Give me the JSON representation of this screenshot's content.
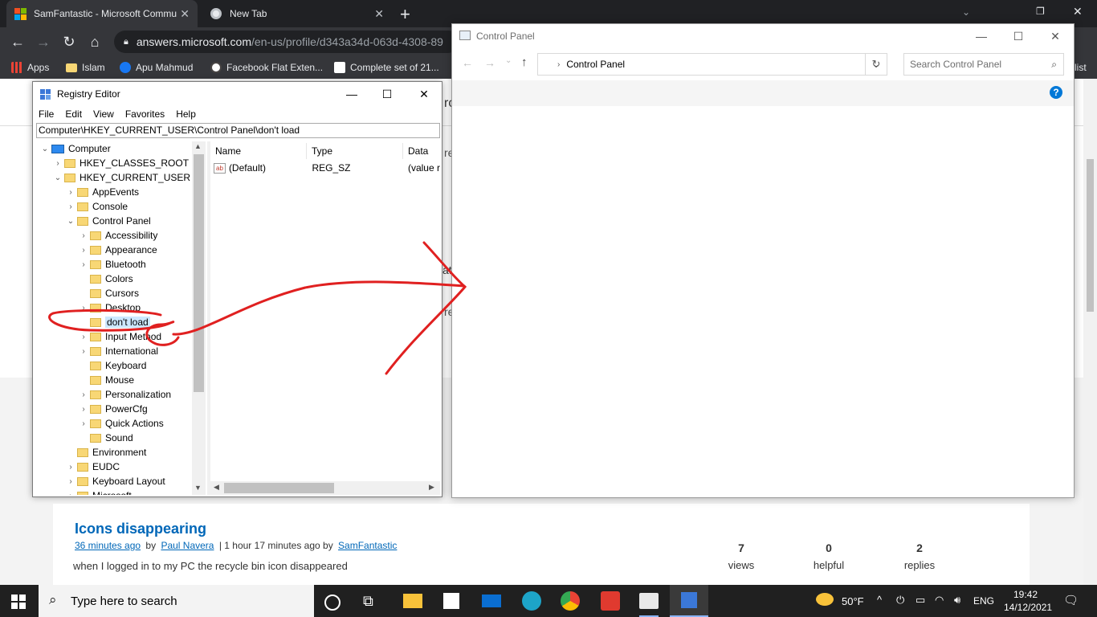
{
  "browser": {
    "tabs": [
      {
        "title": "SamFantastic - Microsoft Commu",
        "active": true
      },
      {
        "title": "New Tab",
        "active": false
      }
    ],
    "new_tab": "+",
    "url_domain": "answers.microsoft.com",
    "url_path": "/en-us/profile/d343a34d-063d-4308-89",
    "bookmarks": [
      {
        "label": "Apps",
        "icon": "apps-grid-icon"
      },
      {
        "label": "Islam",
        "icon": "folder-icon"
      },
      {
        "label": "Apu Mahmud",
        "icon": "facebook-icon"
      },
      {
        "label": "Facebook Flat Exten...",
        "icon": "wordpress-icon"
      },
      {
        "label": "Complete set of 21...",
        "icon": "amazon-icon"
      }
    ],
    "bookmark_overflow": "list"
  },
  "page": {
    "post_title": "Icons disappearing",
    "meta_time": "36 minutes ago",
    "meta_by": "by",
    "meta_author": "Paul Navera",
    "meta_sep": "| 1 hour 17 minutes ago by",
    "meta_last": "SamFantastic",
    "excerpt": "when I logged in to my PC the recycle bin icon disappeared",
    "stats": [
      {
        "value": "7",
        "label": "views"
      },
      {
        "value": "0",
        "label": "helpful"
      },
      {
        "value": "2",
        "label": "replies"
      }
    ],
    "peek_text_1": "ro",
    "peek_text_2": "re",
    "peek_text_3": "at",
    "peek_text_4": "re"
  },
  "regedit": {
    "title": "Registry Editor",
    "menu": [
      "File",
      "Edit",
      "View",
      "Favorites",
      "Help"
    ],
    "address": "Computer\\HKEY_CURRENT_USER\\Control Panel\\don't load",
    "tree": [
      {
        "label": "Computer",
        "level": 0,
        "arrow": "down",
        "icon": "computer"
      },
      {
        "label": "HKEY_CLASSES_ROOT",
        "level": 1,
        "arrow": "right"
      },
      {
        "label": "HKEY_CURRENT_USER",
        "level": 1,
        "arrow": "down"
      },
      {
        "label": "AppEvents",
        "level": 2,
        "arrow": "right"
      },
      {
        "label": "Console",
        "level": 2,
        "arrow": "right"
      },
      {
        "label": "Control Panel",
        "level": 2,
        "arrow": "down"
      },
      {
        "label": "Accessibility",
        "level": 3,
        "arrow": "right"
      },
      {
        "label": "Appearance",
        "level": 3,
        "arrow": "right"
      },
      {
        "label": "Bluetooth",
        "level": 3,
        "arrow": "right"
      },
      {
        "label": "Colors",
        "level": 3,
        "arrow": ""
      },
      {
        "label": "Cursors",
        "level": 3,
        "arrow": ""
      },
      {
        "label": "Desktop",
        "level": 3,
        "arrow": "right"
      },
      {
        "label": "don't load",
        "level": 3,
        "arrow": "",
        "selected": true
      },
      {
        "label": "Input Method",
        "level": 3,
        "arrow": "right"
      },
      {
        "label": "International",
        "level": 3,
        "arrow": "right"
      },
      {
        "label": "Keyboard",
        "level": 3,
        "arrow": ""
      },
      {
        "label": "Mouse",
        "level": 3,
        "arrow": ""
      },
      {
        "label": "Personalization",
        "level": 3,
        "arrow": "right"
      },
      {
        "label": "PowerCfg",
        "level": 3,
        "arrow": "right"
      },
      {
        "label": "Quick Actions",
        "level": 3,
        "arrow": "right"
      },
      {
        "label": "Sound",
        "level": 3,
        "arrow": ""
      },
      {
        "label": "Environment",
        "level": 2,
        "arrow": ""
      },
      {
        "label": "EUDC",
        "level": 2,
        "arrow": "right"
      },
      {
        "label": "Keyboard Layout",
        "level": 2,
        "arrow": "right"
      },
      {
        "label": "Microsoft",
        "level": 2,
        "arrow": "right"
      }
    ],
    "columns": {
      "name": "Name",
      "type": "Type",
      "data": "Data"
    },
    "values": [
      {
        "name": "(Default)",
        "type": "REG_SZ",
        "data": "(value r"
      }
    ]
  },
  "control_panel": {
    "title": "Control Panel",
    "address": "Control Panel",
    "search_placeholder": "Search Control Panel",
    "help": "?"
  },
  "taskbar": {
    "search_placeholder": "Type here to search",
    "weather": "50°F",
    "language": "ENG",
    "time": "19:42",
    "date": "14/12/2021"
  },
  "colors": {
    "annotation_red": "#e02020",
    "link_blue": "#0067b8",
    "chrome_dark": "#202124",
    "accent": "#0078d7"
  }
}
